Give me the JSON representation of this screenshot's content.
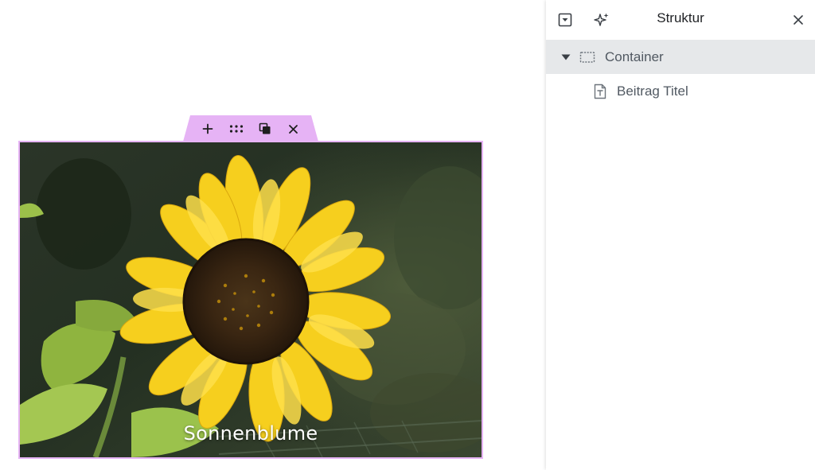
{
  "canvas": {
    "toolbar": {
      "add_icon": "plus-icon",
      "drag_icon": "drag-handle-icon",
      "duplicate_icon": "duplicate-icon",
      "delete_icon": "close-icon"
    },
    "image": {
      "caption": "Sonnenblume"
    }
  },
  "panel": {
    "title": "Struktur",
    "header_icons": [
      "dropdown-toggle-icon",
      "ai-sparkle-icon",
      "close-icon"
    ],
    "tree": [
      {
        "label": "Container",
        "icon": "container-icon",
        "expanded": true,
        "selected": true
      },
      {
        "label": "Beitrag Titel",
        "icon": "text-document-icon",
        "expanded": false,
        "selected": false
      }
    ]
  },
  "colors": {
    "selection_accent": "#e6b3f5",
    "selected_row": "#e6e8ea",
    "tree_text": "#515962",
    "title_text": "#1f2124"
  }
}
